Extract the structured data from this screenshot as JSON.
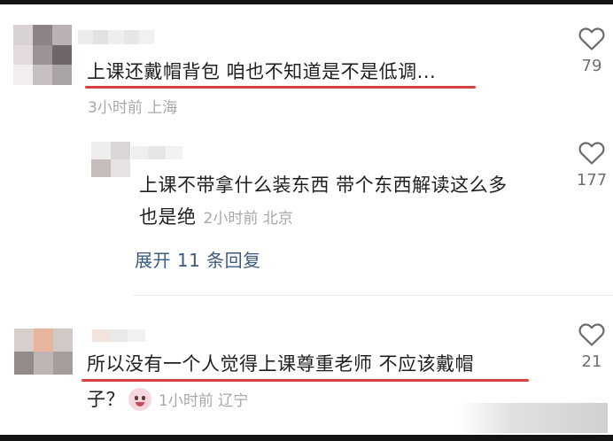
{
  "comments": [
    {
      "text": "上课还戴帽背包 咱也不知道是不是低调...",
      "time": "3小时前",
      "location": "上海",
      "likes": "79",
      "like_icon": "heart-outline-icon"
    },
    {
      "text_line1": "上课不带拿什么装东西 带个东西解读这么多",
      "text_line2": "也是绝",
      "time": "2小时前",
      "location": "北京",
      "likes": "177",
      "like_icon": "heart-outline-icon"
    },
    {
      "text_line1": "所以没有一个人觉得上课尊重老师 不应该戴帽",
      "text_line2": "子？",
      "emoji": "crying-face-emoji",
      "time": "1小时前",
      "location": "辽宁",
      "likes": "21",
      "like_icon": "heart-outline-icon"
    }
  ],
  "expand_replies": "展开 11 条回复",
  "colors": {
    "highlight_underline": "#d9413f",
    "expand_link": "#3d5a80",
    "meta": "#a8a8a8",
    "like_count": "#6f6f6f"
  }
}
